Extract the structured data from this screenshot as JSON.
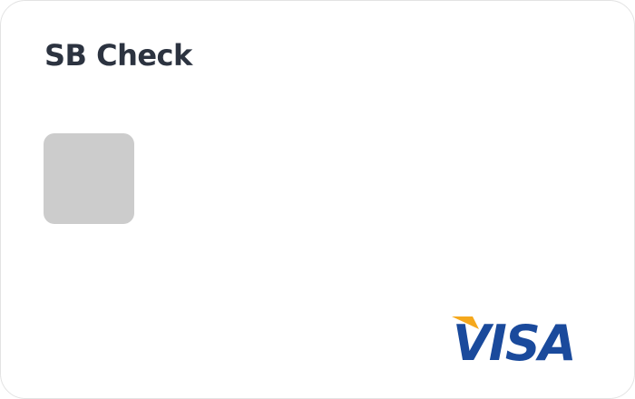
{
  "card": {
    "title": "SB Check",
    "chip_icon": "card-chip-icon",
    "brand": {
      "name": "VISA",
      "icon": "visa-logo-icon",
      "text_color": "#1a4a9c",
      "accent_color": "#f5a81c"
    }
  },
  "colors": {
    "title": "#2c3340",
    "chip": "#cccccc",
    "background": "#ffffff"
  }
}
